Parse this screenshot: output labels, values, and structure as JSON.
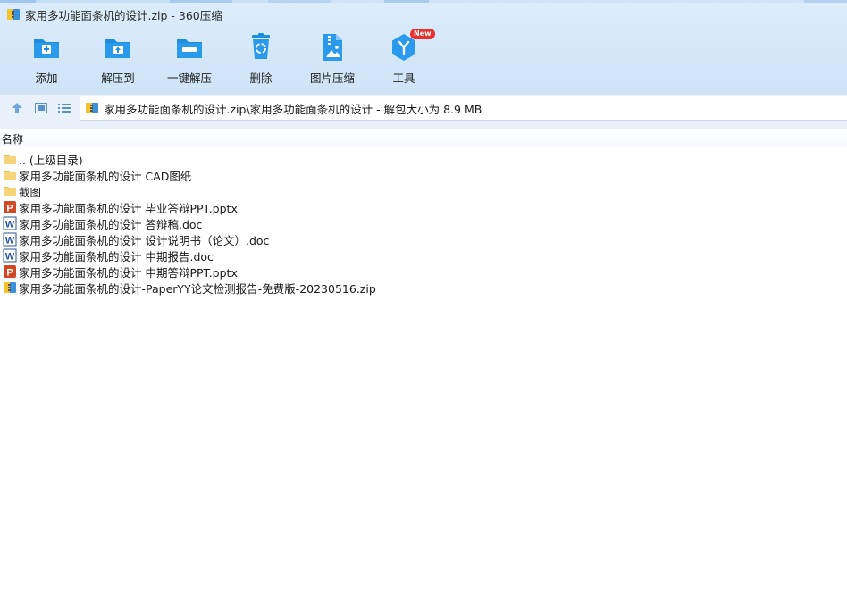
{
  "window": {
    "title": "家用多功能面条机的设计.zip - 360压缩"
  },
  "toolbar": {
    "add_label": "添加",
    "extract_to_label": "解压到",
    "one_click_extract_label": "一键解压",
    "delete_label": "删除",
    "image_compress_label": "图片压缩",
    "tools_label": "工具",
    "tools_badge": "New"
  },
  "address": {
    "path": "家用多功能面条机的设计.zip\\家用多功能面条机的设计 - 解包大小为 8.9 MB"
  },
  "filelist": {
    "column_name": "名称",
    "items": [
      {
        "name": ".. (上级目录)",
        "icon": "folder-icon"
      },
      {
        "name": "家用多功能面条机的设计 CAD图纸",
        "icon": "file-icon"
      },
      {
        "name": "截图",
        "icon": "folder-icon"
      },
      {
        "name": "家用多功能面条机的设计 毕业答辩PPT.pptx",
        "icon": "powerpoint-icon"
      },
      {
        "name": "家用多功能面条机的设计 答辩稿.doc",
        "icon": "word-icon"
      },
      {
        "name": "家用多功能面条机的设计 设计说明书（论文）.doc",
        "icon": "word-icon"
      },
      {
        "name": "家用多功能面条机的设计 中期报告.doc",
        "icon": "word-icon"
      },
      {
        "name": "家用多功能面条机的设计 中期答辩PPT.pptx",
        "icon": "powerpoint-icon"
      },
      {
        "name": "家用多功能面条机的设计-PaperYY论文检测报告-免费版-20230516.zip",
        "icon": "zip-icon"
      }
    ]
  },
  "colors": {
    "toolbar_bg": "#d3e6f8",
    "icon_blue": "#1f8ee0",
    "ppt_red": "#d24726",
    "word_blue": "#2b579a",
    "folder_yellow": "#f6d47a",
    "badge_red": "#e8312f"
  }
}
